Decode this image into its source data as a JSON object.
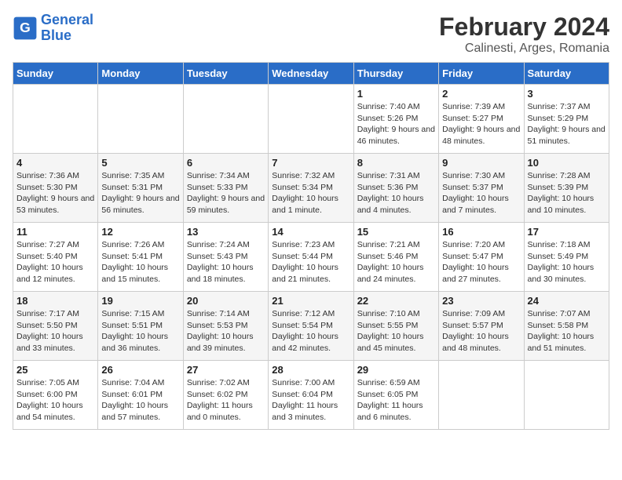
{
  "logo": {
    "text_general": "General",
    "text_blue": "Blue"
  },
  "title": "February 2024",
  "location": "Calinesti, Arges, Romania",
  "days_of_week": [
    "Sunday",
    "Monday",
    "Tuesday",
    "Wednesday",
    "Thursday",
    "Friday",
    "Saturday"
  ],
  "weeks": [
    [
      {
        "day": "",
        "info": ""
      },
      {
        "day": "",
        "info": ""
      },
      {
        "day": "",
        "info": ""
      },
      {
        "day": "",
        "info": ""
      },
      {
        "day": "1",
        "sunrise": "7:40 AM",
        "sunset": "5:26 PM",
        "daylight": "9 hours and 46 minutes."
      },
      {
        "day": "2",
        "sunrise": "7:39 AM",
        "sunset": "5:27 PM",
        "daylight": "9 hours and 48 minutes."
      },
      {
        "day": "3",
        "sunrise": "7:37 AM",
        "sunset": "5:29 PM",
        "daylight": "9 hours and 51 minutes."
      }
    ],
    [
      {
        "day": "4",
        "sunrise": "7:36 AM",
        "sunset": "5:30 PM",
        "daylight": "9 hours and 53 minutes."
      },
      {
        "day": "5",
        "sunrise": "7:35 AM",
        "sunset": "5:31 PM",
        "daylight": "9 hours and 56 minutes."
      },
      {
        "day": "6",
        "sunrise": "7:34 AM",
        "sunset": "5:33 PM",
        "daylight": "9 hours and 59 minutes."
      },
      {
        "day": "7",
        "sunrise": "7:32 AM",
        "sunset": "5:34 PM",
        "daylight": "10 hours and 1 minute."
      },
      {
        "day": "8",
        "sunrise": "7:31 AM",
        "sunset": "5:36 PM",
        "daylight": "10 hours and 4 minutes."
      },
      {
        "day": "9",
        "sunrise": "7:30 AM",
        "sunset": "5:37 PM",
        "daylight": "10 hours and 7 minutes."
      },
      {
        "day": "10",
        "sunrise": "7:28 AM",
        "sunset": "5:39 PM",
        "daylight": "10 hours and 10 minutes."
      }
    ],
    [
      {
        "day": "11",
        "sunrise": "7:27 AM",
        "sunset": "5:40 PM",
        "daylight": "10 hours and 12 minutes."
      },
      {
        "day": "12",
        "sunrise": "7:26 AM",
        "sunset": "5:41 PM",
        "daylight": "10 hours and 15 minutes."
      },
      {
        "day": "13",
        "sunrise": "7:24 AM",
        "sunset": "5:43 PM",
        "daylight": "10 hours and 18 minutes."
      },
      {
        "day": "14",
        "sunrise": "7:23 AM",
        "sunset": "5:44 PM",
        "daylight": "10 hours and 21 minutes."
      },
      {
        "day": "15",
        "sunrise": "7:21 AM",
        "sunset": "5:46 PM",
        "daylight": "10 hours and 24 minutes."
      },
      {
        "day": "16",
        "sunrise": "7:20 AM",
        "sunset": "5:47 PM",
        "daylight": "10 hours and 27 minutes."
      },
      {
        "day": "17",
        "sunrise": "7:18 AM",
        "sunset": "5:49 PM",
        "daylight": "10 hours and 30 minutes."
      }
    ],
    [
      {
        "day": "18",
        "sunrise": "7:17 AM",
        "sunset": "5:50 PM",
        "daylight": "10 hours and 33 minutes."
      },
      {
        "day": "19",
        "sunrise": "7:15 AM",
        "sunset": "5:51 PM",
        "daylight": "10 hours and 36 minutes."
      },
      {
        "day": "20",
        "sunrise": "7:14 AM",
        "sunset": "5:53 PM",
        "daylight": "10 hours and 39 minutes."
      },
      {
        "day": "21",
        "sunrise": "7:12 AM",
        "sunset": "5:54 PM",
        "daylight": "10 hours and 42 minutes."
      },
      {
        "day": "22",
        "sunrise": "7:10 AM",
        "sunset": "5:55 PM",
        "daylight": "10 hours and 45 minutes."
      },
      {
        "day": "23",
        "sunrise": "7:09 AM",
        "sunset": "5:57 PM",
        "daylight": "10 hours and 48 minutes."
      },
      {
        "day": "24",
        "sunrise": "7:07 AM",
        "sunset": "5:58 PM",
        "daylight": "10 hours and 51 minutes."
      }
    ],
    [
      {
        "day": "25",
        "sunrise": "7:05 AM",
        "sunset": "6:00 PM",
        "daylight": "10 hours and 54 minutes."
      },
      {
        "day": "26",
        "sunrise": "7:04 AM",
        "sunset": "6:01 PM",
        "daylight": "10 hours and 57 minutes."
      },
      {
        "day": "27",
        "sunrise": "7:02 AM",
        "sunset": "6:02 PM",
        "daylight": "11 hours and 0 minutes."
      },
      {
        "day": "28",
        "sunrise": "7:00 AM",
        "sunset": "6:04 PM",
        "daylight": "11 hours and 3 minutes."
      },
      {
        "day": "29",
        "sunrise": "6:59 AM",
        "sunset": "6:05 PM",
        "daylight": "11 hours and 6 minutes."
      },
      {
        "day": "",
        "info": ""
      },
      {
        "day": "",
        "info": ""
      }
    ]
  ]
}
